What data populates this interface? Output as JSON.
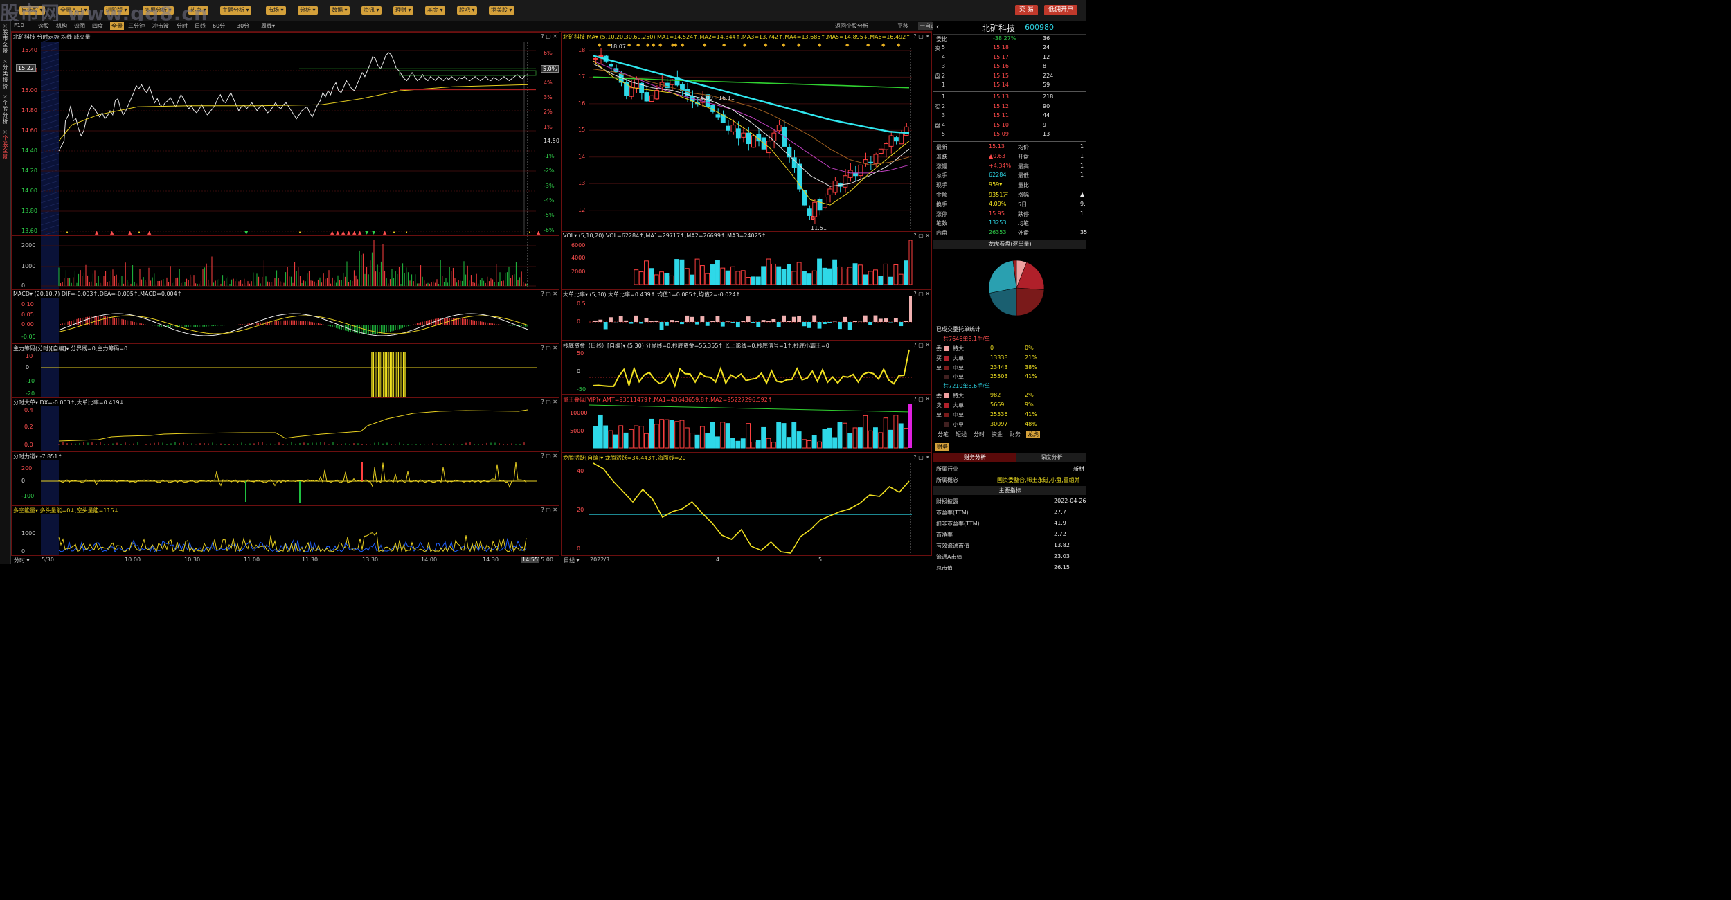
{
  "watermark": "股市网 www.gg8.cn",
  "toolbar": {
    "buttons": [
      "自选股",
      "全景入口",
      "进阶版",
      "多屏分析",
      "热点",
      "主题分析",
      "市场",
      "分析",
      "数据",
      "资讯",
      "理财",
      "基金",
      "股吧",
      "港美股"
    ],
    "trade": "交 易",
    "low_open": "低佣开户"
  },
  "subbar": {
    "left_items": [
      "F10",
      "诊股",
      "机构",
      "识图",
      "四度",
      "全景",
      "三分钟",
      "冲击波",
      "分时",
      "日线",
      "60分",
      "30分",
      "周线▾"
    ],
    "active": "全景",
    "right_items": [
      "返回个股分析",
      "平移",
      "一自选 ▾"
    ]
  },
  "left_strip": [
    "股市全景",
    "分类报价",
    "个股分析",
    "个股全景"
  ],
  "intraday": {
    "title": "北矿科技 分时走势 均线 成交量",
    "price_labels": [
      "15.40",
      "15.20",
      "15.00",
      "14.80",
      "14.60",
      "14.40",
      "14.20",
      "14.00",
      "13.80",
      "13.60"
    ],
    "current_price_tag": "15.22",
    "pct_labels": [
      "6%",
      "5%",
      "4%",
      "3%",
      "2%",
      "1%",
      "",
      "-1%",
      "-2%",
      "-3%",
      "-4%",
      "-5%",
      "-6%"
    ],
    "pct_tag": "5.0%",
    "base_label": "14.50",
    "volume_labels": [
      "2000",
      "1000",
      "0"
    ],
    "macd_title": "MACD▾ (20,10,7) DIF=-0.003↑,DEA=-0.005↑,MACD=0.004↑",
    "macd_labels": [
      "0.10",
      "0.05",
      "0.00",
      "-0.05"
    ],
    "main_chip_title": "主力筹码(分时)[自编]▾ 分界线=0,主力筹码=0",
    "main_chip_labels": [
      "10",
      "0",
      "-10",
      "-20"
    ],
    "big_order_title": "分时大单▾ DX=-0.003↑,大单比率=0.419↓",
    "big_order_labels": [
      "0.4",
      "0.2",
      "0.0"
    ],
    "force_title": "分时力道▾ -7.851↑",
    "force_labels": [
      "200",
      "0",
      "-100"
    ],
    "energy_title": "多空能量▾ 多头量能=0↓,空头量能=115↓",
    "energy_labels": [
      "1000",
      "0"
    ],
    "time_labels": [
      "5/30",
      "10:00",
      "10:30",
      "11:00",
      "11:30",
      "13:30",
      "14:00",
      "14:30",
      "14:55",
      "15:00"
    ],
    "time_sel": "分时 ▾"
  },
  "kline": {
    "title": "北矿科技 MA▾ (5,10,20,30,60,250) MA1=14.524↑,MA2=14.344↑,MA3=13.742↑,MA4=13.685↑,MA5=14.895↓,MA6=16.492↑",
    "price_labels": [
      "18",
      "17",
      "16",
      "15",
      "14",
      "13",
      "12"
    ],
    "high_mark": "18.07",
    "low_mark": "11.51",
    "range_mark": "16.09 - 16.11",
    "b_mark": "B",
    "vol_title": "VOL▾ (5,10,20) VOL=62284↑,MA1=29717↑,MA2=26699↑,MA3=24025↑",
    "vol_labels": [
      "6000",
      "4000",
      "2000"
    ],
    "big_ratio_title": "大单比率▾ (5,30) 大单比率=0.439↑,均值1=0.085↑,均值2=-0.024↑",
    "big_ratio_labels": [
      "0.5",
      "0"
    ],
    "bottom_fund_title": "抄底资金（日线）[自编]▾ (5,30) 分界线=0,抄底资金=55.355↑,长上影线=0,抄底信号=1↑,抄底小霸王=0",
    "bottom_fund_labels": [
      "50",
      "0",
      "-50"
    ],
    "volume_king_title": "量王叠现[VIP]▾ AMT=93511479↑,MA1=43643659.8↑,MA2=95227296.592↑",
    "volume_king_labels": [
      "10000",
      "5000"
    ],
    "dragon_title": "龙腾活跃[自编]▾ 龙腾活跃=34.443↑,海面线=20",
    "dragon_labels": [
      "40",
      "20",
      "0"
    ],
    "date_labels": [
      "2022/3",
      "4",
      "5"
    ],
    "date_sel": "日线 ▾"
  },
  "right_panel": {
    "name": "北矿科技",
    "code": "600980",
    "weibi_label": "委比",
    "weibi_value": "-38.27%",
    "weibi_vol": "36",
    "asks": [
      {
        "side": "卖",
        "level": "5",
        "price": "15.18",
        "vol": "24"
      },
      {
        "side": "",
        "level": "4",
        "price": "15.17",
        "vol": "12"
      },
      {
        "side": "",
        "level": "3",
        "price": "15.16",
        "vol": "8"
      },
      {
        "side": "盘",
        "level": "2",
        "price": "15.15",
        "vol": "224"
      },
      {
        "side": "",
        "level": "1",
        "price": "15.14",
        "vol": "59"
      }
    ],
    "bids": [
      {
        "side": "",
        "level": "1",
        "price": "15.13",
        "vol": "218"
      },
      {
        "side": "买",
        "level": "2",
        "price": "15.12",
        "vol": "90"
      },
      {
        "side": "",
        "level": "3",
        "price": "15.11",
        "vol": "44"
      },
      {
        "side": "盘",
        "level": "4",
        "price": "15.10",
        "vol": "9"
      },
      {
        "side": "",
        "level": "5",
        "price": "15.09",
        "vol": "13"
      }
    ],
    "quote": [
      {
        "l": "最新",
        "v": "15.13",
        "c": "red",
        "l2": "均价",
        "v2": "1"
      },
      {
        "l": "涨跌",
        "v": "▲0.63",
        "c": "red",
        "l2": "开盘",
        "v2": "1"
      },
      {
        "l": "涨幅",
        "v": "+4.34%",
        "c": "red",
        "l2": "最高",
        "v2": "1"
      },
      {
        "l": "总手",
        "v": "62284",
        "c": "cyan",
        "l2": "最低",
        "v2": "1"
      },
      {
        "l": "现手",
        "v": "959▾",
        "c": "yellow",
        "l2": "量比",
        "v2": ""
      },
      {
        "l": "金额",
        "v": "9351万",
        "c": "yellow",
        "l2": "涨幅",
        "v2": "▲"
      },
      {
        "l": "换手",
        "v": "4.09%",
        "c": "yellow",
        "l2": "5日",
        "v2": "9."
      },
      {
        "l": "涨停",
        "v": "15.95",
        "c": "red",
        "l2": "跌停",
        "v2": "1"
      },
      {
        "l": "笔数",
        "v": "13253",
        "c": "cyan",
        "l2": "均笔",
        "v2": ""
      },
      {
        "l": "内盘",
        "v": "26353",
        "c": "green",
        "l2": "外盘",
        "v2": "35"
      }
    ],
    "pie_title": "龙虎看盘(逐单量)",
    "entrust_title": "已成交委托单统计",
    "buy_summary": "共7646单8.1手/单",
    "buy_rows": [
      {
        "side": "委",
        "type": "特大",
        "vol": "0",
        "pct": "0%"
      },
      {
        "side": "买",
        "type": "大单",
        "vol": "13338",
        "pct": "21%"
      },
      {
        "side": "单",
        "type": "中单",
        "vol": "23443",
        "pct": "38%"
      },
      {
        "side": "",
        "type": "小单",
        "vol": "25503",
        "pct": "41%"
      }
    ],
    "sell_summary": "共7210单8.6手/单",
    "sell_rows": [
      {
        "side": "委",
        "type": "特大",
        "vol": "982",
        "pct": "2%"
      },
      {
        "side": "卖",
        "type": "大单",
        "vol": "5669",
        "pct": "9%"
      },
      {
        "side": "单",
        "type": "中单",
        "vol": "25536",
        "pct": "41%"
      },
      {
        "side": "",
        "type": "小单",
        "vol": "30097",
        "pct": "48%"
      }
    ],
    "tabs": [
      "分笔",
      "短线",
      "分时",
      "资金",
      "财务",
      "龙虎"
    ],
    "active_tab": "龙虎",
    "finance_tab": "财务",
    "fin_analysis": "财务分析",
    "deep_analysis": "深度分析",
    "industry_label": "所属行业",
    "industry_value": "新材",
    "concept_label": "所属概念",
    "concept_value": "国资委整合,稀土永磁,小盘,重组并",
    "main_index": "主要指标",
    "fin_rows": [
      {
        "l": "财报披露",
        "v": "2022-04-26"
      },
      {
        "l": "市盈率(TTM)",
        "v": "27.7"
      },
      {
        "l": "扣非市盈率(TTM)",
        "v": "41.9"
      },
      {
        "l": "市净率",
        "v": "2.72"
      },
      {
        "l": "有效流通市值",
        "v": "13.82"
      },
      {
        "l": "流通A市值",
        "v": "23.03"
      },
      {
        "l": "总市值",
        "v": "26.15"
      }
    ]
  },
  "colors": {
    "up": "#ff4a4a",
    "down": "#2ed8e8",
    "border": "#6b0f0f",
    "accent": "#d4a03a"
  }
}
